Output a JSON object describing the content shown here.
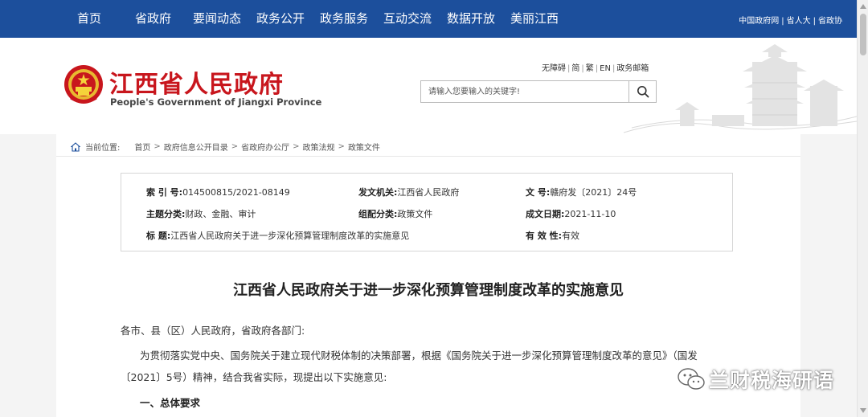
{
  "nav": {
    "items": [
      "首页",
      "省政府",
      "要闻动态",
      "政务公开",
      "政务服务",
      "互动交流",
      "数据开放",
      "美丽江西"
    ],
    "links": [
      "中国政府网",
      "省人大",
      "省政协"
    ]
  },
  "header": {
    "title": "江西省人民政府",
    "subtitle": "People's Government of Jiangxi Province",
    "links": [
      "无障碍",
      "简",
      "繁",
      "EN",
      "政务邮箱"
    ],
    "search_placeholder": "请输入您要输入的关键字!"
  },
  "breadcrumb": {
    "label": "当前位置:",
    "items": [
      "首页",
      "政府信息公开目录",
      "省政府办公厅",
      "政策法规",
      "政策文件"
    ]
  },
  "meta": {
    "index_label": "索  引  号:",
    "index_value": "014500815/2021-08149",
    "issuer_label": "发文机关:",
    "issuer_value": "江西省人民政府",
    "docno_label": "文      号:",
    "docno_value": "赣府发〔2021〕24号",
    "topic_label": "主题分类:",
    "topic_value": "财政、金融、审计",
    "category_label": "组配分类:",
    "category_value": "政策文件",
    "date_label": "成文日期:",
    "date_value": "2021-11-10",
    "title_label": "标      题:",
    "title_value": "江西省人民政府关于进一步深化预算管理制度改革的实施意见",
    "validity_label": "有 效 性:",
    "validity_value": "有效"
  },
  "doc": {
    "title": "江西省人民政府关于进一步深化预算管理制度改革的实施意见",
    "salutation": "各市、县（区）人民政府，省政府各部门:",
    "para1_line1": "为贯彻落实党中央、国务院关于建立现代财税体制的决策部署，根据《国务院关于进一步深化预算管理制度改革的意见》（国发",
    "para1_line2": "〔2021〕5号）精神，结合我省实际，现提出以下实施意见:",
    "heading1": "一、总体要求"
  },
  "watermark": {
    "text": "兰财税海研语"
  },
  "colors": {
    "nav_bg": "#1c4f9c",
    "title_red": "#c8161d"
  }
}
